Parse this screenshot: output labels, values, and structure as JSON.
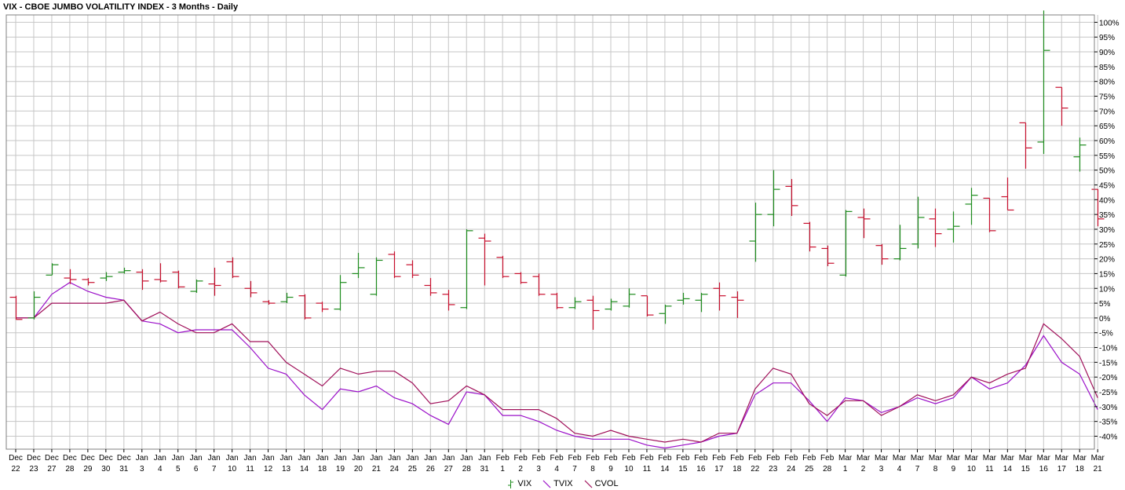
{
  "chart_data": {
    "type": "line",
    "title": "VIX - CBOE JUMBO VOLATILITY INDEX - 3 Months - Daily",
    "x_labels": [
      [
        "Dec",
        "22"
      ],
      [
        "Dec",
        "23"
      ],
      [
        "Dec",
        "27"
      ],
      [
        "Dec",
        "28"
      ],
      [
        "Dec",
        "29"
      ],
      [
        "Dec",
        "30"
      ],
      [
        "Dec",
        "31"
      ],
      [
        "Jan",
        "3"
      ],
      [
        "Jan",
        "4"
      ],
      [
        "Jan",
        "5"
      ],
      [
        "Jan",
        "6"
      ],
      [
        "Jan",
        "7"
      ],
      [
        "Jan",
        "10"
      ],
      [
        "Jan",
        "11"
      ],
      [
        "Jan",
        "12"
      ],
      [
        "Jan",
        "13"
      ],
      [
        "Jan",
        "14"
      ],
      [
        "Jan",
        "18"
      ],
      [
        "Jan",
        "19"
      ],
      [
        "Jan",
        "20"
      ],
      [
        "Jan",
        "21"
      ],
      [
        "Jan",
        "24"
      ],
      [
        "Jan",
        "25"
      ],
      [
        "Jan",
        "26"
      ],
      [
        "Jan",
        "27"
      ],
      [
        "Jan",
        "28"
      ],
      [
        "Jan",
        "31"
      ],
      [
        "Feb",
        "1"
      ],
      [
        "Feb",
        "2"
      ],
      [
        "Feb",
        "3"
      ],
      [
        "Feb",
        "4"
      ],
      [
        "Feb",
        "7"
      ],
      [
        "Feb",
        "8"
      ],
      [
        "Feb",
        "9"
      ],
      [
        "Feb",
        "10"
      ],
      [
        "Feb",
        "11"
      ],
      [
        "Feb",
        "14"
      ],
      [
        "Feb",
        "15"
      ],
      [
        "Feb",
        "16"
      ],
      [
        "Feb",
        "17"
      ],
      [
        "Feb",
        "18"
      ],
      [
        "Feb",
        "22"
      ],
      [
        "Feb",
        "23"
      ],
      [
        "Feb",
        "24"
      ],
      [
        "Feb",
        "25"
      ],
      [
        "Feb",
        "28"
      ],
      [
        "Mar",
        "1"
      ],
      [
        "Mar",
        "2"
      ],
      [
        "Mar",
        "3"
      ],
      [
        "Mar",
        "4"
      ],
      [
        "Mar",
        "7"
      ],
      [
        "Mar",
        "8"
      ],
      [
        "Mar",
        "9"
      ],
      [
        "Mar",
        "10"
      ],
      [
        "Mar",
        "11"
      ],
      [
        "Mar",
        "14"
      ],
      [
        "Mar",
        "15"
      ],
      [
        "Mar",
        "16"
      ],
      [
        "Mar",
        "17"
      ],
      [
        "Mar",
        "18"
      ],
      [
        "Mar",
        "21"
      ]
    ],
    "y_axis": {
      "min": -40,
      "max": 100,
      "step": 5,
      "unit": "%",
      "position": "right",
      "ticks": [
        "-40%",
        "-35%",
        "-30%",
        "-25%",
        "-20%",
        "-15%",
        "-10%",
        "-5%",
        "0%",
        "5%",
        "10%",
        "15%",
        "20%",
        "25%",
        "30%",
        "35%",
        "40%",
        "45%",
        "50%",
        "55%",
        "60%",
        "65%",
        "70%",
        "75%",
        "80%",
        "85%",
        "90%",
        "95%",
        "100%"
      ]
    },
    "grid": true,
    "legend_position": "bottom-center",
    "colors": {
      "up": "#1e8c1e",
      "down": "#c8102e",
      "tvix": "#9b10c9",
      "cvol": "#a0105a",
      "grid": "#c6c6c6"
    },
    "series": [
      {
        "name": "VIX",
        "style": "ohlc-bars",
        "ohlc": [
          [
            7,
            7.5,
            -0.5,
            -0.5
          ],
          [
            0,
            9,
            -0.5,
            7
          ],
          [
            14.5,
            18.5,
            14.5,
            18
          ],
          [
            13.5,
            16.5,
            11.5,
            13
          ],
          [
            13,
            13.5,
            11,
            12
          ],
          [
            13.5,
            15.5,
            12.5,
            14
          ],
          [
            15.5,
            17,
            15,
            16
          ],
          [
            15.5,
            16.5,
            9.5,
            12.5
          ],
          [
            13,
            18.5,
            12,
            12.5
          ],
          [
            15.5,
            16,
            10,
            10.5
          ],
          [
            9,
            13,
            8.5,
            12.5
          ],
          [
            11.5,
            17,
            7.5,
            11
          ],
          [
            19,
            20.5,
            13.5,
            14
          ],
          [
            10,
            12.5,
            7,
            8.5
          ],
          [
            5.5,
            6,
            4.5,
            5
          ],
          [
            5.5,
            8.5,
            5,
            7
          ],
          [
            7.5,
            8,
            -0.5,
            0
          ],
          [
            5,
            5.5,
            2,
            3
          ],
          [
            3,
            14.5,
            2.5,
            12
          ],
          [
            15,
            22,
            13.5,
            17
          ],
          [
            8,
            20.5,
            7.5,
            19.5
          ],
          [
            21.5,
            22.5,
            13.5,
            14
          ],
          [
            18,
            19.5,
            13.5,
            14.5
          ],
          [
            11,
            13.5,
            7.5,
            8.5
          ],
          [
            8,
            9.5,
            2.5,
            4.5
          ],
          [
            3.5,
            30,
            3,
            29.5
          ],
          [
            27,
            28.5,
            11,
            26
          ],
          [
            20.5,
            21,
            13.5,
            14
          ],
          [
            15,
            15.5,
            11.5,
            12
          ],
          [
            14,
            15,
            7.5,
            8
          ],
          [
            8,
            8.5,
            3,
            3.5
          ],
          [
            3.5,
            7,
            3,
            5.5
          ],
          [
            6,
            7.5,
            -4,
            2.5
          ],
          [
            3,
            6.5,
            2.5,
            5.5
          ],
          [
            4,
            10,
            3.5,
            8
          ],
          [
            7.5,
            7.5,
            0.5,
            1
          ],
          [
            1.5,
            4.5,
            -2,
            4
          ],
          [
            6,
            8.5,
            4.5,
            6.5
          ],
          [
            6,
            8.5,
            2,
            8
          ],
          [
            10,
            12,
            2.5,
            7.5
          ],
          [
            7,
            9,
            0,
            6
          ],
          [
            26,
            39,
            19,
            35
          ],
          [
            35,
            50,
            31,
            43.5
          ],
          [
            44.5,
            47,
            34.5,
            38
          ],
          [
            32,
            32.5,
            22.5,
            24
          ],
          [
            23.5,
            24.5,
            17.5,
            18.5
          ],
          [
            14.5,
            36.5,
            14,
            36
          ],
          [
            34,
            37,
            27,
            33.5
          ],
          [
            24.5,
            25,
            18,
            20
          ],
          [
            20,
            31.5,
            19.5,
            23.5
          ],
          [
            25,
            41,
            23.5,
            34
          ],
          [
            33.5,
            37,
            24,
            28.5
          ],
          [
            30,
            36,
            25.5,
            31
          ],
          [
            38.5,
            44,
            31.5,
            41.5
          ],
          [
            40.5,
            40.5,
            29,
            29.5
          ],
          [
            41,
            47.5,
            36.5,
            36.5
          ],
          [
            66,
            66,
            50.5,
            57.5
          ],
          [
            59.5,
            104,
            55.5,
            90.5
          ],
          [
            78,
            78,
            65,
            71
          ],
          [
            54.5,
            61,
            49.5,
            58.5
          ],
          [
            43.5,
            43.5,
            31,
            33.5
          ]
        ]
      },
      {
        "name": "TVIX",
        "style": "line",
        "values": [
          0,
          0,
          8,
          12,
          9,
          7,
          6,
          -1,
          -2,
          -5,
          -4,
          -4,
          -4,
          -10,
          -17,
          -19,
          -26,
          -31,
          -24,
          -25,
          -23,
          -27,
          -29,
          -33,
          -36,
          -25,
          -26,
          -33,
          -33,
          -35,
          -38,
          -40,
          -41,
          -41,
          -41,
          -43,
          -44,
          -43,
          -42,
          -40,
          -39,
          -26,
          -22,
          -22,
          -28,
          -35,
          -27,
          -28,
          -32,
          -30,
          -27,
          -29,
          -27,
          -20,
          -24,
          -22,
          -16,
          -6,
          -15,
          -19,
          -31
        ]
      },
      {
        "name": "CVOL",
        "style": "line",
        "values": [
          0,
          0,
          5,
          5,
          5,
          5,
          6,
          -1,
          2,
          -2,
          -5,
          -5,
          -2,
          -8,
          -8,
          -15,
          -19,
          -23,
          -17,
          -19,
          -18,
          -18,
          -22,
          -29,
          -28,
          -23,
          -26,
          -31,
          -31,
          -31,
          -34,
          -39,
          -40,
          -38,
          -40,
          -41,
          -42,
          -41,
          -42,
          -39,
          -39,
          -24,
          -17,
          -19,
          -29,
          -33,
          -28,
          -28,
          -33,
          -30,
          -26,
          -28,
          -26,
          -20,
          -22,
          -19,
          -17,
          -2,
          -7,
          -13,
          -27
        ]
      }
    ]
  }
}
